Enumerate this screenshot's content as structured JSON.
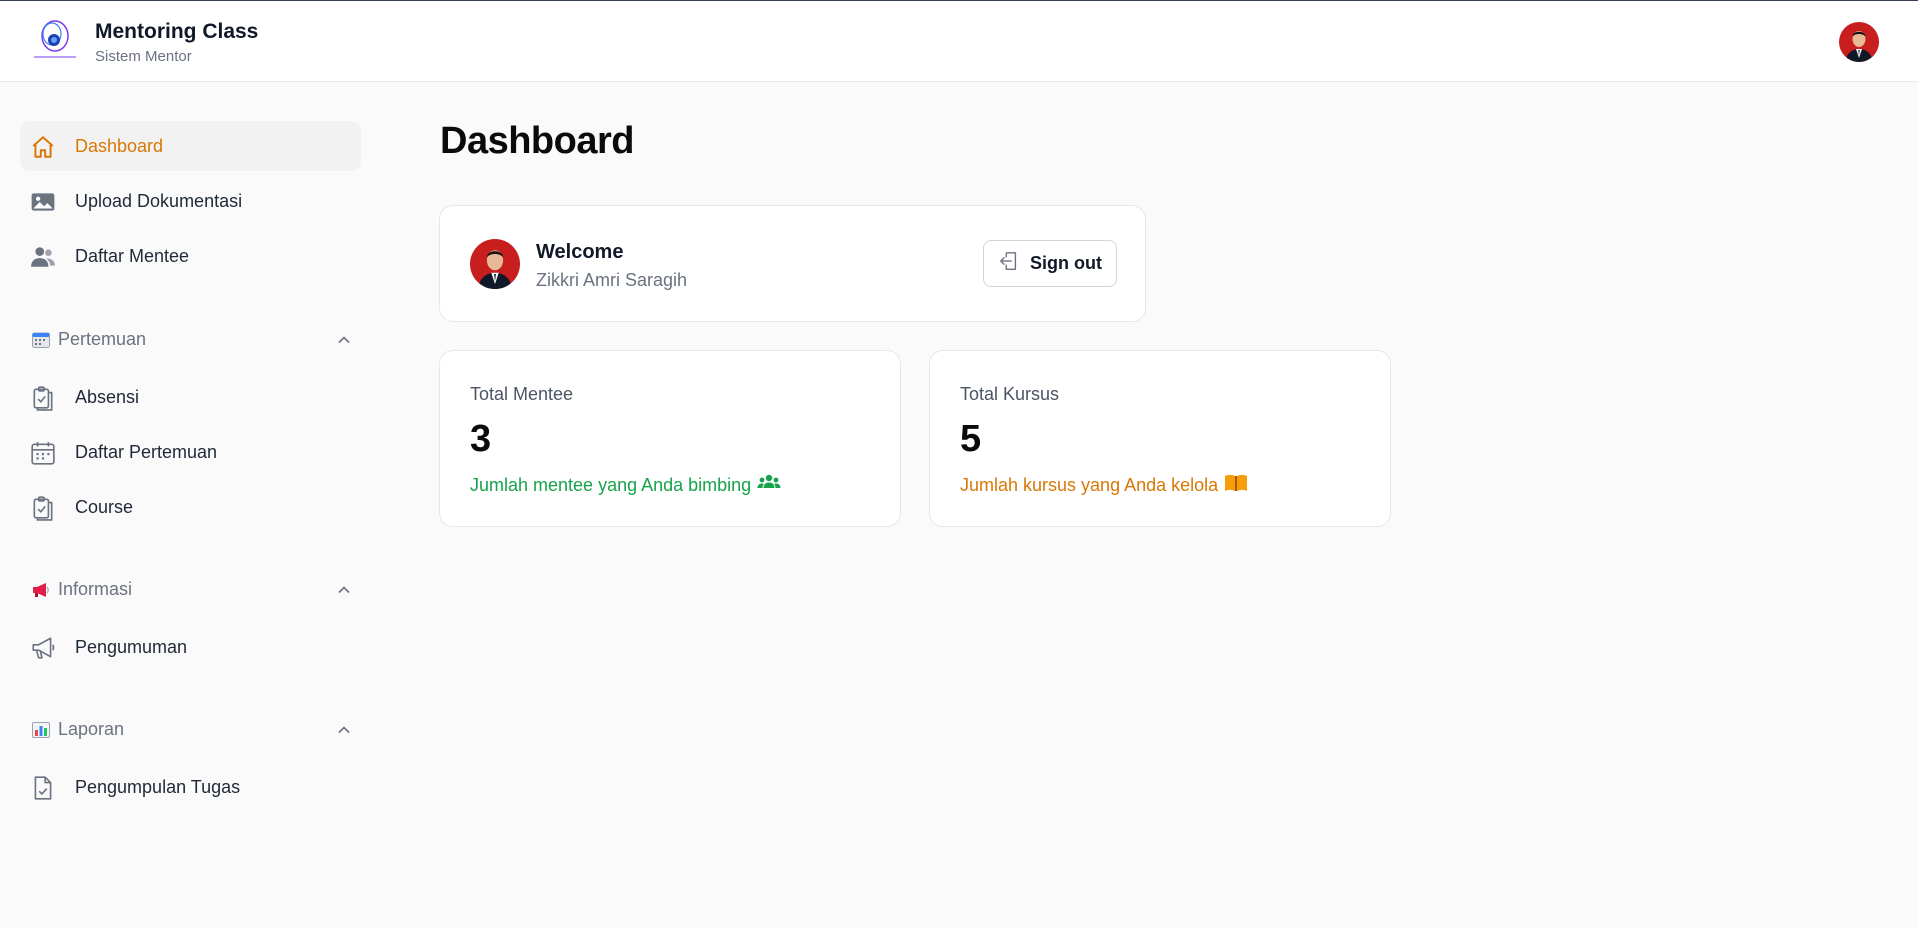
{
  "header": {
    "app_title": "Mentoring Class",
    "app_subtitle": "Sistem Mentor"
  },
  "sidebar": {
    "items_top": [
      {
        "label": "Dashboard",
        "icon": "home-icon",
        "active": true
      },
      {
        "label": "Upload Dokumentasi",
        "icon": "image-icon"
      },
      {
        "label": "Daftar Mentee",
        "icon": "users-icon"
      }
    ],
    "sections": [
      {
        "label": "Pertemuan",
        "emoji": "calendar-emoji",
        "items": [
          {
            "label": "Absensi",
            "icon": "clipboard-check-icon"
          },
          {
            "label": "Daftar Pertemuan",
            "icon": "calendar-icon"
          },
          {
            "label": "Course",
            "icon": "clipboard-check-icon"
          }
        ]
      },
      {
        "label": "Informasi",
        "emoji": "megaphone-emoji",
        "items": [
          {
            "label": "Pengumuman",
            "icon": "megaphone-icon"
          }
        ]
      },
      {
        "label": "Laporan",
        "emoji": "bar-chart-emoji",
        "items": [
          {
            "label": "Pengumpulan Tugas",
            "icon": "document-check-icon"
          }
        ]
      }
    ]
  },
  "main": {
    "page_title": "Dashboard",
    "welcome": {
      "title": "Welcome",
      "name": "Zikkri Amri Saragih",
      "signout_label": "Sign out"
    },
    "stats": [
      {
        "label": "Total Mentee",
        "value": "3",
        "desc": "Jumlah mentee yang Anda bimbing",
        "icon": "users-group-icon",
        "color": "#16a34a"
      },
      {
        "label": "Total Kursus",
        "value": "5",
        "desc": "Jumlah kursus yang Anda kelola",
        "icon": "book-open-icon",
        "color": "#d97706"
      }
    ]
  },
  "colors": {
    "accent": "#d97706",
    "success": "#16a34a",
    "muted": "#6b7280"
  }
}
